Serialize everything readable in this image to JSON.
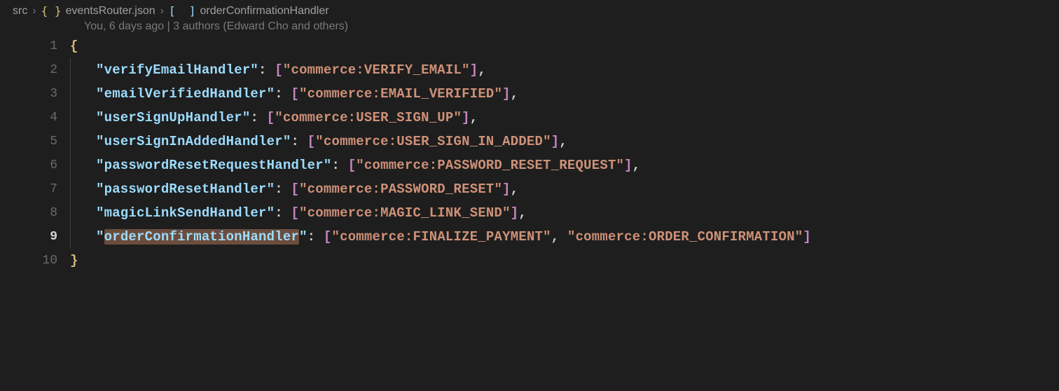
{
  "breadcrumbs": {
    "folder": "src",
    "file": "eventsRouter.json",
    "symbol": "orderConfirmationHandler"
  },
  "gitlens": "You, 6 days ago | 3 authors (Edward Cho and others)",
  "active_line": "9",
  "lines": [
    {
      "n": "1",
      "indent": 0,
      "segments": [
        {
          "cls": "brace",
          "t": "{"
        }
      ]
    },
    {
      "n": "2",
      "indent": 1,
      "segments": [
        {
          "cls": "key",
          "t": "\"verifyEmailHandler\""
        },
        {
          "cls": "colon",
          "t": ": "
        },
        {
          "cls": "bracket",
          "t": "["
        },
        {
          "cls": "str",
          "t": "\"commerce:VERIFY_EMAIL\""
        },
        {
          "cls": "bracket",
          "t": "]"
        },
        {
          "cls": "punct",
          "t": ","
        }
      ]
    },
    {
      "n": "3",
      "indent": 1,
      "segments": [
        {
          "cls": "key",
          "t": "\"emailVerifiedHandler\""
        },
        {
          "cls": "colon",
          "t": ": "
        },
        {
          "cls": "bracket",
          "t": "["
        },
        {
          "cls": "str",
          "t": "\"commerce:EMAIL_VERIFIED\""
        },
        {
          "cls": "bracket",
          "t": "]"
        },
        {
          "cls": "punct",
          "t": ","
        }
      ]
    },
    {
      "n": "4",
      "indent": 1,
      "segments": [
        {
          "cls": "key",
          "t": "\"userSignUpHandler\""
        },
        {
          "cls": "colon",
          "t": ": "
        },
        {
          "cls": "bracket",
          "t": "["
        },
        {
          "cls": "str",
          "t": "\"commerce:USER_SIGN_UP\""
        },
        {
          "cls": "bracket",
          "t": "]"
        },
        {
          "cls": "punct",
          "t": ","
        }
      ]
    },
    {
      "n": "5",
      "indent": 1,
      "segments": [
        {
          "cls": "key",
          "t": "\"userSignInAddedHandler\""
        },
        {
          "cls": "colon",
          "t": ": "
        },
        {
          "cls": "bracket",
          "t": "["
        },
        {
          "cls": "str",
          "t": "\"commerce:USER_SIGN_IN_ADDED\""
        },
        {
          "cls": "bracket",
          "t": "]"
        },
        {
          "cls": "punct",
          "t": ","
        }
      ]
    },
    {
      "n": "6",
      "indent": 1,
      "segments": [
        {
          "cls": "key",
          "t": "\"passwordResetRequestHandler\""
        },
        {
          "cls": "colon",
          "t": ": "
        },
        {
          "cls": "bracket",
          "t": "["
        },
        {
          "cls": "str",
          "t": "\"commerce:PASSWORD_RESET_REQUEST\""
        },
        {
          "cls": "bracket",
          "t": "]"
        },
        {
          "cls": "punct",
          "t": ","
        }
      ]
    },
    {
      "n": "7",
      "indent": 1,
      "segments": [
        {
          "cls": "key",
          "t": "\"passwordResetHandler\""
        },
        {
          "cls": "colon",
          "t": ": "
        },
        {
          "cls": "bracket",
          "t": "["
        },
        {
          "cls": "str",
          "t": "\"commerce:PASSWORD_RESET\""
        },
        {
          "cls": "bracket",
          "t": "]"
        },
        {
          "cls": "punct",
          "t": ","
        }
      ]
    },
    {
      "n": "8",
      "indent": 1,
      "segments": [
        {
          "cls": "key",
          "t": "\"magicLinkSendHandler\""
        },
        {
          "cls": "colon",
          "t": ": "
        },
        {
          "cls": "bracket",
          "t": "["
        },
        {
          "cls": "str",
          "t": "\"commerce:MAGIC_LINK_SEND\""
        },
        {
          "cls": "bracket",
          "t": "]"
        },
        {
          "cls": "punct",
          "t": ","
        }
      ]
    },
    {
      "n": "9",
      "indent": 1,
      "segments": [
        {
          "cls": "key",
          "t": "\""
        },
        {
          "cls": "key hl-selection",
          "t": "orderConfirmationHandler"
        },
        {
          "cls": "key",
          "t": "\""
        },
        {
          "cls": "colon",
          "t": ": "
        },
        {
          "cls": "bracket",
          "t": "["
        },
        {
          "cls": "str",
          "t": "\"commerce:FINALIZE_PAYMENT\""
        },
        {
          "cls": "punct",
          "t": ", "
        },
        {
          "cls": "str",
          "t": "\"commerce:ORDER_CONFIRMATION\""
        },
        {
          "cls": "bracket",
          "t": "]"
        }
      ]
    },
    {
      "n": "10",
      "indent": 0,
      "segments": [
        {
          "cls": "brace",
          "t": "}"
        }
      ]
    }
  ]
}
